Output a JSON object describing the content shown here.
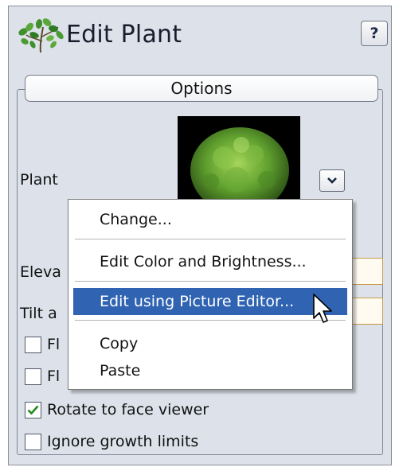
{
  "window": {
    "title": "Edit Plant",
    "help_label": "?"
  },
  "options": {
    "header": "Options"
  },
  "fields": {
    "plant_label": "Plant",
    "elevation_label_visible": "Eleva",
    "tilt_label_visible": "Tilt a"
  },
  "checkboxes": [
    {
      "label": "Fl",
      "checked": false
    },
    {
      "label": "Fl",
      "checked": false
    },
    {
      "label": "Rotate to face viewer",
      "checked": true
    },
    {
      "label": "Ignore growth limits",
      "checked": false
    }
  ],
  "context_menu": {
    "items": [
      {
        "label": "Change..."
      },
      {
        "label": "Edit Color and Brightness..."
      },
      {
        "label": "Edit using Picture Editor...",
        "selected": true
      },
      {
        "label": "Copy"
      },
      {
        "label": "Paste"
      }
    ]
  },
  "colors": {
    "panel_bg": "#dde2ea",
    "menu_highlight": "#3064b3",
    "field_border": "#c79a46",
    "check_mark": "#1e8a1e"
  },
  "icons": [
    "plant-icon",
    "chevron-down-icon",
    "checkmark-icon",
    "mouse-pointer-icon"
  ]
}
